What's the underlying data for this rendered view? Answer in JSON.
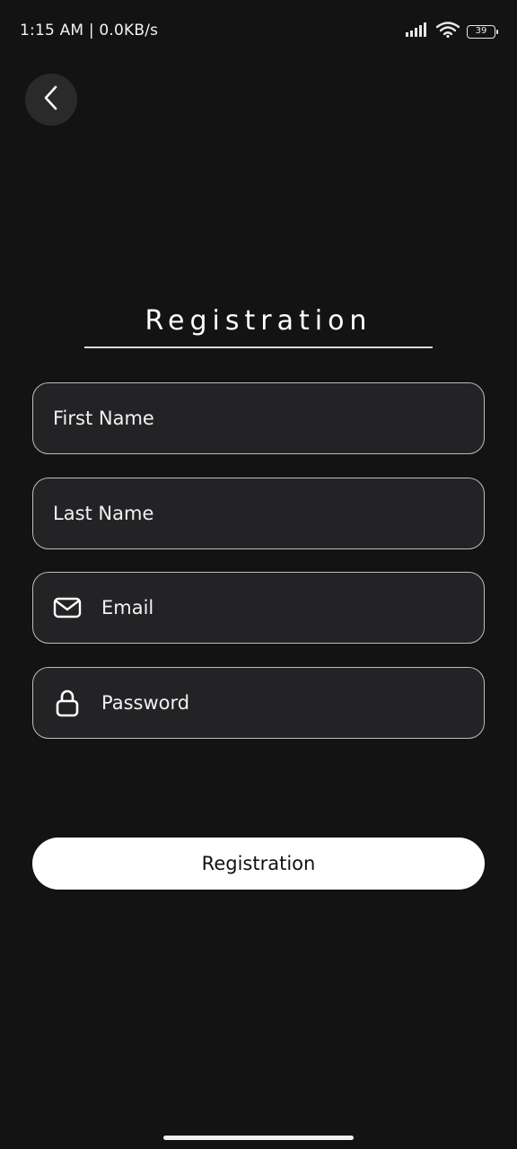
{
  "status_bar": {
    "time": "1:15 AM | 0.0KB/s",
    "battery": "39",
    "icons": [
      "signal-icon",
      "wifi-icon",
      "battery-icon"
    ]
  },
  "header": {
    "back_icon": "chevron-left-icon"
  },
  "title": "Registration",
  "form": {
    "first_name": {
      "placeholder": "First Name",
      "value": ""
    },
    "last_name": {
      "placeholder": "Last Name",
      "value": ""
    },
    "email": {
      "placeholder": "Email",
      "value": "",
      "icon": "mail-icon"
    },
    "password": {
      "placeholder": "Password",
      "value": "",
      "icon": "lock-icon"
    }
  },
  "submit_label": "Registration",
  "colors": {
    "background": "#131313",
    "field_background": "#232325",
    "field_border": "#bdbdbd",
    "button_background": "#ffffff",
    "button_text": "#111111"
  }
}
